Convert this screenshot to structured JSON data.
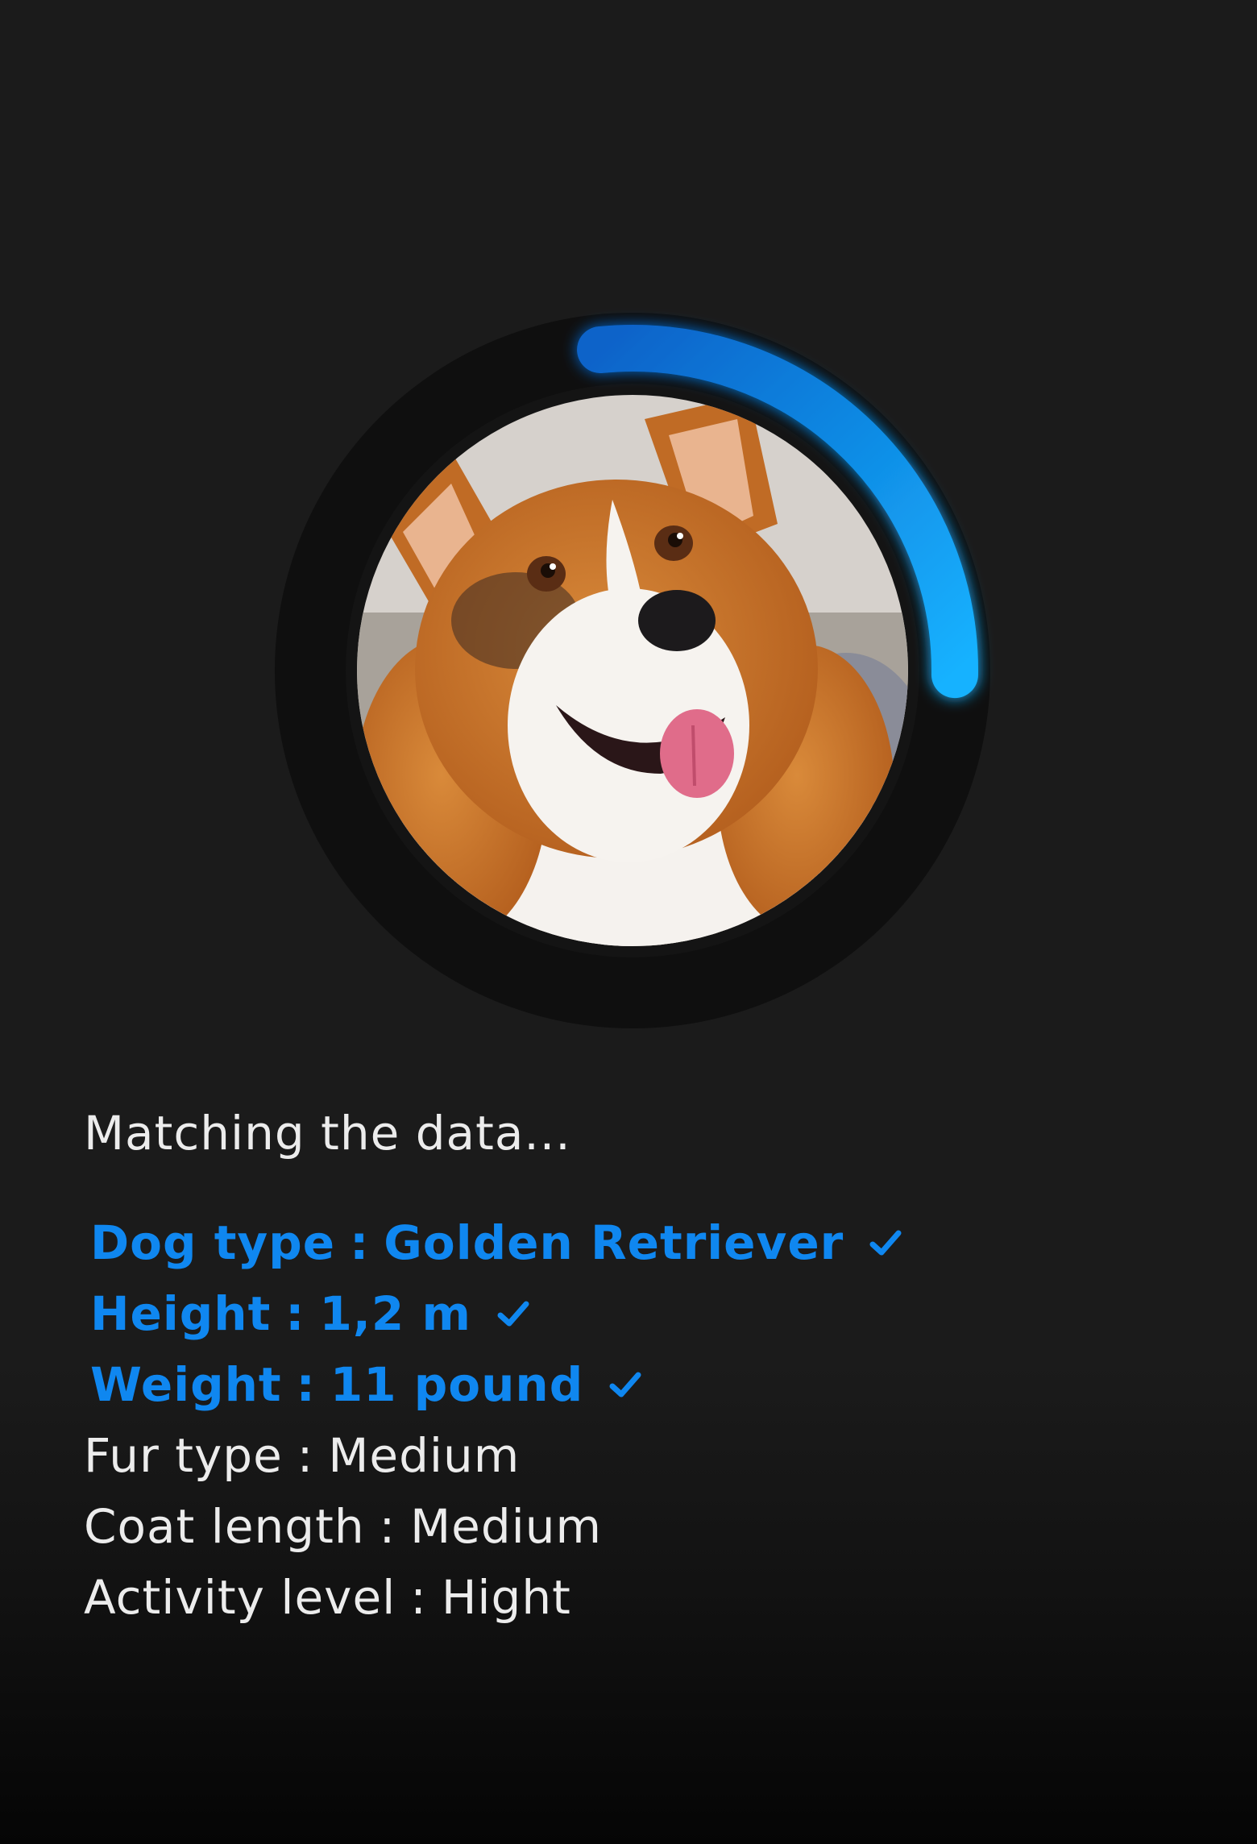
{
  "progress": {
    "fraction": 0.26,
    "colors": {
      "track": "#0f0f0f",
      "arc_start": "#0a63c9",
      "arc_end": "#16b2ff"
    }
  },
  "photo": {
    "alt": "Corgi dog photo"
  },
  "status_text": "Matching the data...",
  "attributes": [
    {
      "label": "Dog type",
      "value": "Golden Retriever",
      "matched": true
    },
    {
      "label": "Height",
      "value": "1,2 m",
      "matched": true
    },
    {
      "label": "Weight",
      "value": "11 pound",
      "matched": true
    },
    {
      "label": "Fur type",
      "value": "Medium",
      "matched": false
    },
    {
      "label": "Coat length",
      "value": "Medium",
      "matched": false
    },
    {
      "label": "Activity level",
      "value": "Hight",
      "matched": false
    }
  ],
  "colors": {
    "background": "#1b1b1b",
    "accent": "#0f87f0",
    "text": "#ececec"
  },
  "icons": {
    "matched": "check-icon"
  }
}
